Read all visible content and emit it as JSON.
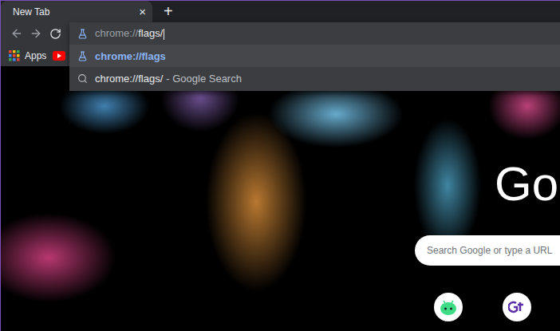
{
  "window": {
    "title": "New Tab"
  },
  "tabs": [
    {
      "label": "New Tab",
      "selected": true,
      "close": "×"
    }
  ],
  "new_tab_button": "+",
  "omnibox": {
    "scheme": "chrome://",
    "rest": "flags/",
    "suggestions": [
      {
        "kind": "url",
        "text": "chrome://flags",
        "suffix": "",
        "selected": true
      },
      {
        "kind": "search",
        "text": "chrome://flags/",
        "suffix": "- Google Search",
        "selected": false
      }
    ]
  },
  "bookmarks": [
    {
      "label": "Apps",
      "kind": "apps"
    },
    {
      "label": "",
      "kind": "youtube"
    }
  ],
  "ntp": {
    "logo": "Go",
    "search_placeholder": "Search Google or type a URL",
    "shortcuts": [
      {
        "kind": "android"
      },
      {
        "kind": "gt"
      }
    ]
  }
}
